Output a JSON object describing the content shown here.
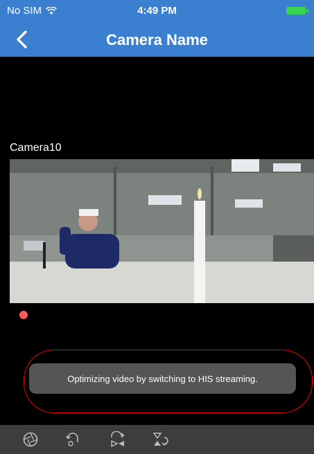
{
  "status_bar": {
    "carrier": "No SIM",
    "time": "4:49 PM",
    "icons": [
      "wifi-icon",
      "battery-charging-icon"
    ],
    "battery_color": "#39d353"
  },
  "header": {
    "title": "Camera Name",
    "back_icon": "chevron-left-icon",
    "background": "#3a7fd0"
  },
  "video": {
    "camera_label": "Camera10",
    "recording_indicator_color": "#ff5a5a"
  },
  "toast": {
    "message": "Optimizing video by switching to HIS streaming.",
    "highlight_color": "#e00000"
  },
  "toolbar": {
    "items": [
      {
        "icon": "aperture-icon"
      },
      {
        "icon": "rotate-icon"
      },
      {
        "icon": "flip-horizontal-icon"
      },
      {
        "icon": "flip-vertical-icon"
      }
    ]
  }
}
